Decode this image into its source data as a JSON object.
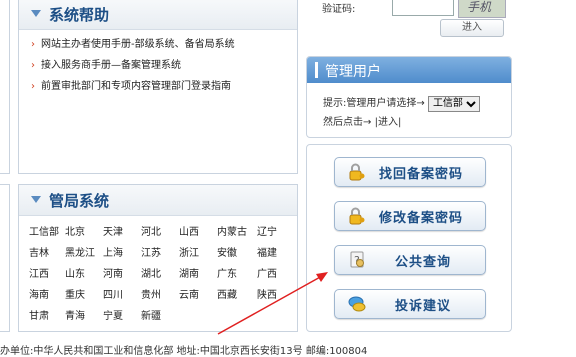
{
  "login": {
    "captcha_label": "验证码:",
    "captcha_image_text": "手机",
    "enter_label": "进入"
  },
  "help": {
    "title": "系统帮助",
    "items": [
      "网站主办者使用手册-部级系统、备省局系统",
      "接入服务商手册—备案管理系统",
      "前置审批部门和专项内容管理部门登录指南"
    ]
  },
  "bureau": {
    "title": "管局系统",
    "rows": [
      [
        "工信部",
        "北京",
        "天津",
        "河北",
        "山西",
        "内蒙古",
        "辽宁"
      ],
      [
        "吉林",
        "黑龙江",
        "上海",
        "江苏",
        "浙江",
        "安徽",
        "福建"
      ],
      [
        "江西",
        "山东",
        "河南",
        "湖北",
        "湖南",
        "广东",
        "广西"
      ],
      [
        "海南",
        "重庆",
        "四川",
        "贵州",
        "云南",
        "西藏",
        "陕西"
      ],
      [
        "甘肃",
        "青海",
        "宁夏",
        "新疆"
      ]
    ]
  },
  "manage": {
    "title": "管理用户",
    "hint": "提示:管理用户请选择→",
    "selected": "工信部",
    "hint2": "然后点击→",
    "enter_link": "|进入|"
  },
  "buttons": {
    "retrieve": "找回备案密码",
    "modify": "修改备案密码",
    "query": "公共查询",
    "complaint": "投诉建议"
  },
  "footer": {
    "text": "办单位:中华人民共和国工业和信息化部 地址:中国北京西长安街13号 邮编:100804"
  },
  "colors": {
    "title_blue": "#1d4f86",
    "header_blue": "#4f8ccc",
    "arrow_red": "#e02020"
  }
}
